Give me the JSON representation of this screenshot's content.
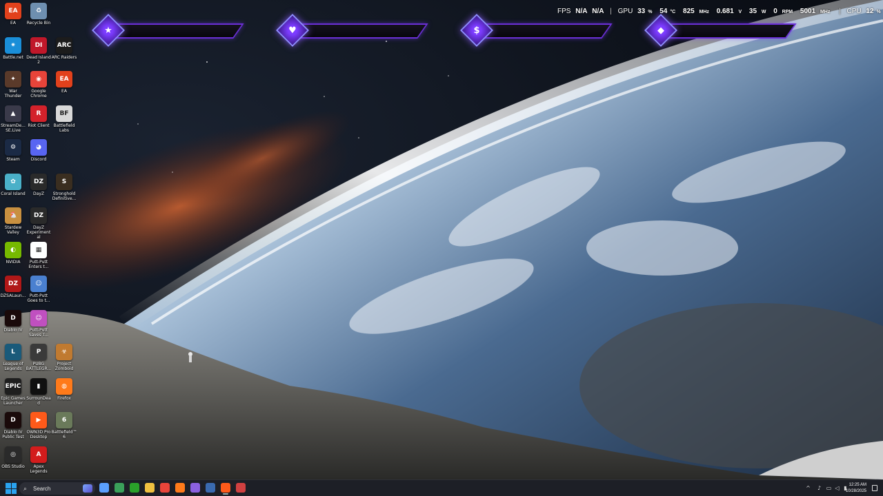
{
  "desktop_icons": [
    {
      "label": "EA",
      "icon": "ea-icon",
      "color": "#e2411c",
      "glyph": "EA"
    },
    {
      "label": "Recycle Bin",
      "icon": "recycle-bin-icon",
      "color": "#6e8fb0",
      "glyph": "♻"
    },
    {
      "label": "Battle.net",
      "icon": "battlenet-icon",
      "color": "#1a8ed8",
      "glyph": "✷"
    },
    {
      "label": "Dead Island 2",
      "icon": "dead-island-2-icon",
      "color": "#c0182a",
      "glyph": "DI"
    },
    {
      "label": "ARC Raiders",
      "icon": "arc-raiders-icon",
      "color": "#1c1c1c",
      "glyph": "ARC"
    },
    {
      "label": "War Thunder",
      "icon": "war-thunder-icon",
      "color": "#5a3a2a",
      "glyph": "✦"
    },
    {
      "label": "Google Chrome",
      "icon": "chrome-icon",
      "color": "#e8443a",
      "glyph": "◉"
    },
    {
      "label": "EA",
      "icon": "ea-icon",
      "color": "#e2411c",
      "glyph": "EA"
    },
    {
      "label": "StreamDe... SE.Live",
      "icon": "streamdeck-icon",
      "color": "#3a3a4a",
      "glyph": "▲"
    },
    {
      "label": "Riot Client",
      "icon": "riot-client-icon",
      "color": "#d3222b",
      "glyph": "R"
    },
    {
      "label": "Battlefield Labs",
      "icon": "battlefield-labs-icon",
      "color": "#d8d8d8",
      "glyph": "BF"
    },
    {
      "label": "Steam",
      "icon": "steam-icon",
      "color": "#1b2a45",
      "glyph": "⚙"
    },
    {
      "label": "Discord",
      "icon": "discord-icon",
      "color": "#5865f2",
      "glyph": "◕"
    },
    {
      "label": "Coral Island",
      "icon": "coral-island-icon",
      "color": "#4ab0c8",
      "glyph": "✿"
    },
    {
      "label": "DayZ",
      "icon": "dayz-icon",
      "color": "#2a2a2a",
      "glyph": "DZ"
    },
    {
      "label": "Stronghold Definitive...",
      "icon": "stronghold-icon",
      "color": "#3a2e20",
      "glyph": "S"
    },
    {
      "label": "Stardew Valley",
      "icon": "stardew-valley-icon",
      "color": "#c89040",
      "glyph": "🐔"
    },
    {
      "label": "DayZ Experimental",
      "icon": "dayz-experimental-icon",
      "color": "#2a2a2a",
      "glyph": "DZ"
    },
    {
      "label": "NVIDIA",
      "icon": "nvidia-icon",
      "color": "#76b900",
      "glyph": "◐"
    },
    {
      "label": "Putt-Putt Enters t...",
      "icon": "putt-putt-icon",
      "color": "#ffffff",
      "glyph": "▦"
    },
    {
      "label": "DZSALaun...",
      "icon": "dzsa-launcher-icon",
      "color": "#b01818",
      "glyph": "DZ"
    },
    {
      "label": "Putt-Putt Goes to t...",
      "icon": "putt-putt-icon",
      "color": "#4a80d0",
      "glyph": "☺"
    },
    {
      "label": "Diablo IV",
      "icon": "diablo-iv-icon",
      "color": "#1a0a0a",
      "glyph": "D"
    },
    {
      "label": "Putt-Putt Saves T...",
      "icon": "putt-putt-icon",
      "color": "#c050c0",
      "glyph": "☺"
    },
    {
      "label": "League of Legends",
      "icon": "league-of-legends-icon",
      "color": "#1a5a7a",
      "glyph": "L"
    },
    {
      "label": "PUBG BATTLEGR...",
      "icon": "pubg-icon",
      "color": "#3a3a3a",
      "glyph": "P"
    },
    {
      "label": "Project Zomboid",
      "icon": "project-zomboid-icon",
      "color": "#c07a30",
      "glyph": "☣"
    },
    {
      "label": "Epic Games Launcher",
      "icon": "epic-games-icon",
      "color": "#1e1e1e",
      "glyph": "EPIC"
    },
    {
      "label": "SurrounDead",
      "icon": "surroundead-icon",
      "color": "#101010",
      "glyph": "▮"
    },
    {
      "label": "Firefox",
      "icon": "firefox-icon",
      "color": "#ff7a1a",
      "glyph": "◍"
    },
    {
      "label": "Diablo IV Public Test",
      "icon": "diablo-iv-icon",
      "color": "#1a0a0a",
      "glyph": "D"
    },
    {
      "label": "OWN3D Pro Desktop",
      "icon": "own3d-pro-icon",
      "color": "#ff5a1a",
      "glyph": "▶"
    },
    {
      "label": "Battlefield™ 6",
      "icon": "battlefield-6-icon",
      "color": "#6a7a5a",
      "glyph": "6"
    },
    {
      "label": "OBS Studio",
      "icon": "obs-studio-icon",
      "color": "#2a2a2a",
      "glyph": "◎"
    },
    {
      "label": "Apex Legends",
      "icon": "apex-legends-icon",
      "color": "#d31c1c",
      "glyph": "A"
    }
  ],
  "widgets": [
    {
      "name": "star-widget",
      "icon": "star-icon",
      "glyph": "★"
    },
    {
      "name": "heart-widget",
      "icon": "heart-icon",
      "glyph": "♥"
    },
    {
      "name": "dollar-widget",
      "icon": "dollar-icon",
      "glyph": "$"
    },
    {
      "name": "diamond-widget",
      "icon": "diamond-icon",
      "glyph": "◆"
    }
  ],
  "perf": {
    "fps_label": "FPS",
    "fps_value1": "N/A",
    "fps_value2": "N/A",
    "gpu_label": "GPU",
    "gpu_load": "33",
    "gpu_load_unit": "%",
    "gpu_temp": "54",
    "gpu_temp_unit": "°C",
    "gpu_clock": "825",
    "gpu_clock_unit": "MHz",
    "gpu_voltage": "0.681",
    "gpu_voltage_unit": "V",
    "gpu_power": "35",
    "gpu_power_unit": "W",
    "gpu_fan": "0",
    "gpu_fan_unit": "RPM",
    "gpu_mem_clock": "5001",
    "gpu_mem_clock_unit": "MHz",
    "cpu_label": "CPU",
    "cpu_load": "12",
    "cpu_load_unit": "%"
  },
  "taskbar": {
    "search_placeholder": "Search",
    "apps": [
      {
        "name": "copilot",
        "color": "#5aa0ff"
      },
      {
        "name": "snipping-tool",
        "color": "#3aa05a"
      },
      {
        "name": "xbox",
        "color": "#2aa02a"
      },
      {
        "name": "file-explorer",
        "color": "#f0c040"
      },
      {
        "name": "chrome",
        "color": "#e8443a"
      },
      {
        "name": "firefox",
        "color": "#ff7a1a"
      },
      {
        "name": "discord-like",
        "color": "#8a60e0"
      },
      {
        "name": "steam",
        "color": "#3a6ab0"
      },
      {
        "name": "own3d",
        "color": "#ff5a1a"
      },
      {
        "name": "browser",
        "color": "#d04040"
      }
    ],
    "time": "12:25 AM",
    "date": "10/28/2025"
  }
}
